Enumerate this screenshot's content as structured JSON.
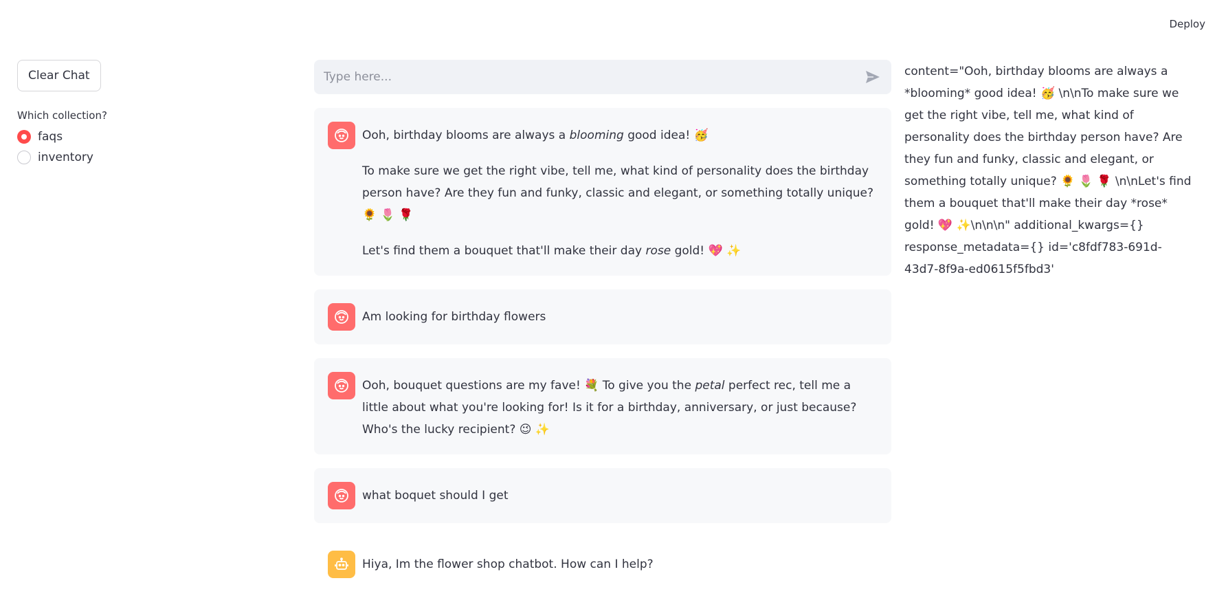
{
  "header": {
    "deploy_label": "Deploy"
  },
  "sidebar": {
    "clear_button": "Clear Chat",
    "radio_label": "Which collection?",
    "options": [
      {
        "label": "faqs",
        "selected": true
      },
      {
        "label": "inventory",
        "selected": false
      }
    ]
  },
  "chat_input": {
    "placeholder": "Type here..."
  },
  "messages": [
    {
      "role": "user",
      "p1_pre": "Ooh, birthday blooms are always a ",
      "p1_em": "blooming",
      "p1_post": " good idea! 🥳",
      "p2": "To make sure we get the right vibe, tell me, what kind of personality does the birthday person have? Are they fun and funky, classic and elegant, or something totally unique? 🌻 🌷 🌹",
      "p3_pre": "Let's find them a bouquet that'll make their day ",
      "p3_em": "rose",
      "p3_post": " gold! 💖 ✨"
    },
    {
      "role": "user",
      "text": "Am looking for birthday flowers"
    },
    {
      "role": "user",
      "pre": "Ooh, bouquet questions are my fave! 💐  To give you the ",
      "em": "petal",
      "post": " perfect rec, tell me a little about what you're looking for! Is it for a birthday, anniversary, or just because? Who's the lucky recipient? 😉 ✨"
    },
    {
      "role": "user",
      "text": "what boquet should I get"
    },
    {
      "role": "assistant",
      "text": "Hiya, Im the flower shop chatbot. How can I help?"
    }
  ],
  "debug_output": "content=\"Ooh, birthday blooms are always a *blooming* good idea! 🥳 \\n\\nTo make sure we get the right vibe, tell me, what kind of personality does the birthday person have? Are they fun and funky, classic and elegant, or something totally unique? 🌻 🌷 🌹 \\n\\nLet's find them a bouquet that'll make their day *rose* gold! 💖 ✨\\n\\n\\n\" additional_kwargs={} response_metadata={} id='c8fdf783-691d-43d7-8f9a-ed0615f5fbd3'",
  "colors": {
    "accent": "#ff4b4b",
    "user_avatar": "#ff6c6c",
    "bot_avatar": "#ffbd45",
    "bubble_bg": "#f7f8fa",
    "input_bg": "#f0f2f6"
  }
}
